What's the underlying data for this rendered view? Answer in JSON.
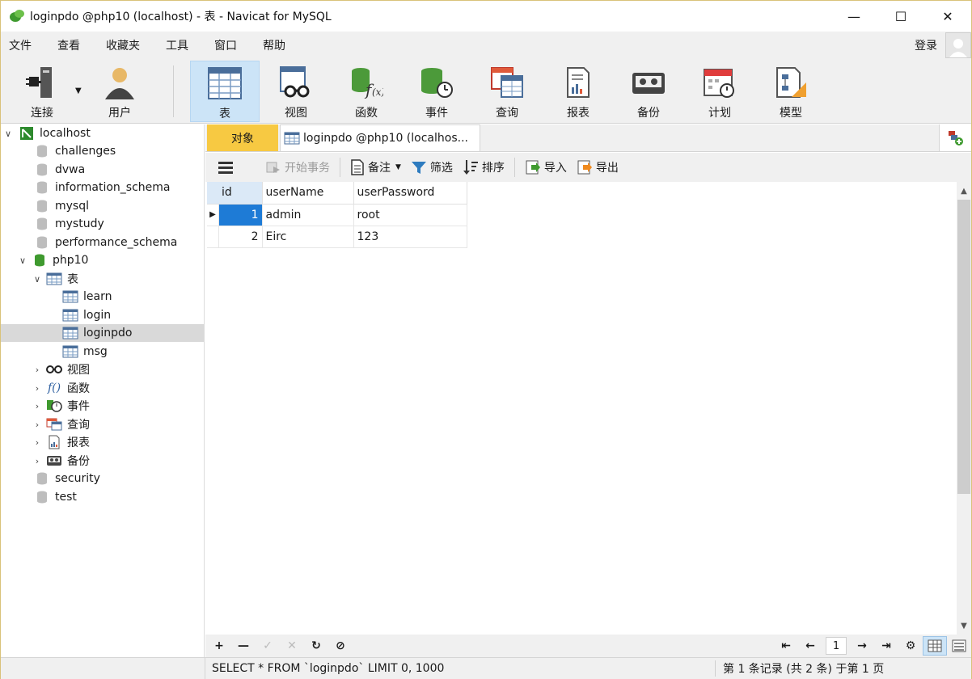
{
  "window": {
    "title": "loginpdo @php10 (localhost) - 表 - Navicat for MySQL"
  },
  "menu": {
    "items": [
      "文件",
      "查看",
      "收藏夹",
      "工具",
      "窗口",
      "帮助"
    ],
    "login": "登录"
  },
  "toolbar": {
    "items": [
      {
        "label": "连接",
        "icon": "plug-icon"
      },
      {
        "label": "用户",
        "icon": "user-icon"
      },
      {
        "label": "表",
        "icon": "table-icon",
        "active": true
      },
      {
        "label": "视图",
        "icon": "view-icon"
      },
      {
        "label": "函数",
        "icon": "function-icon"
      },
      {
        "label": "事件",
        "icon": "event-icon"
      },
      {
        "label": "查询",
        "icon": "query-icon"
      },
      {
        "label": "报表",
        "icon": "report-icon"
      },
      {
        "label": "备份",
        "icon": "backup-icon"
      },
      {
        "label": "计划",
        "icon": "schedule-icon"
      },
      {
        "label": "模型",
        "icon": "model-icon"
      }
    ]
  },
  "sidebar": {
    "connection": "localhost",
    "databases": [
      "challenges",
      "dvwa",
      "information_schema",
      "mysql",
      "mystudy",
      "performance_schema"
    ],
    "open_db": "php10",
    "tables_group": "表",
    "tables": [
      "learn",
      "login",
      "loginpdo",
      "msg"
    ],
    "selected_table": "loginpdo",
    "groups": [
      "视图",
      "函数",
      "事件",
      "查询",
      "报表",
      "备份"
    ],
    "more_dbs": [
      "security",
      "test"
    ]
  },
  "tabs": {
    "objects": "对象",
    "table_tab": "loginpdo @php10 (localhos..."
  },
  "subtoolbar": {
    "begin_tx": "开始事务",
    "comment": "备注",
    "filter": "筛选",
    "sort": "排序",
    "import": "导入",
    "export": "导出"
  },
  "grid": {
    "columns": [
      "id",
      "userName",
      "userPassword"
    ],
    "rows": [
      {
        "id": "1",
        "userName": "admin",
        "userPassword": "root"
      },
      {
        "id": "2",
        "userName": "Eirc",
        "userPassword": "123"
      }
    ]
  },
  "pager": {
    "page": "1"
  },
  "status": {
    "sql": "SELECT * FROM `loginpdo` LIMIT 0, 1000",
    "records": "第 1 条记录 (共 2 条) 于第 1 页"
  },
  "colors": {
    "accent": "#f7c942",
    "selection": "#1e7bd6",
    "active_tool": "#cce4f7"
  }
}
